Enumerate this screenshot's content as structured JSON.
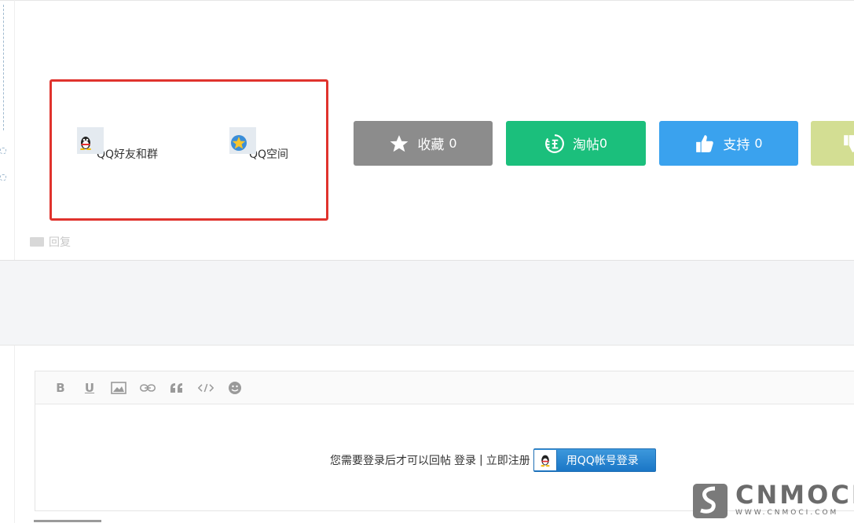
{
  "share": {
    "items": [
      {
        "label": "QQ好友和群",
        "icon": "qq-penguin-icon"
      },
      {
        "label": "QQ空间",
        "icon": "qzone-star-icon"
      }
    ]
  },
  "actions": {
    "favorite": {
      "label": "收藏",
      "count": "0"
    },
    "taotie": {
      "label": "淘帖",
      "count": "0"
    },
    "support": {
      "label": "支持",
      "count": "0"
    }
  },
  "reply_link": {
    "label": "回复"
  },
  "editor": {
    "tools": [
      "bold-icon",
      "underline-icon",
      "image-icon",
      "link-icon",
      "quote-icon",
      "code-icon",
      "emoji-icon"
    ],
    "login_prompt": "您需要登录后才可以回帖",
    "login_link": "登录",
    "separator": "|",
    "register_link": "立即注册",
    "qq_login": "用QQ帐号登录"
  },
  "watermark": {
    "title": "CNMOCI",
    "subtitle": "WWW.CNMOCI.COM"
  },
  "colors": {
    "highlight": "#e0332d",
    "favorite": "#8c8c8c",
    "taotie": "#1bbf7c",
    "support": "#3aa2ee",
    "oppose": "#d3de93"
  }
}
